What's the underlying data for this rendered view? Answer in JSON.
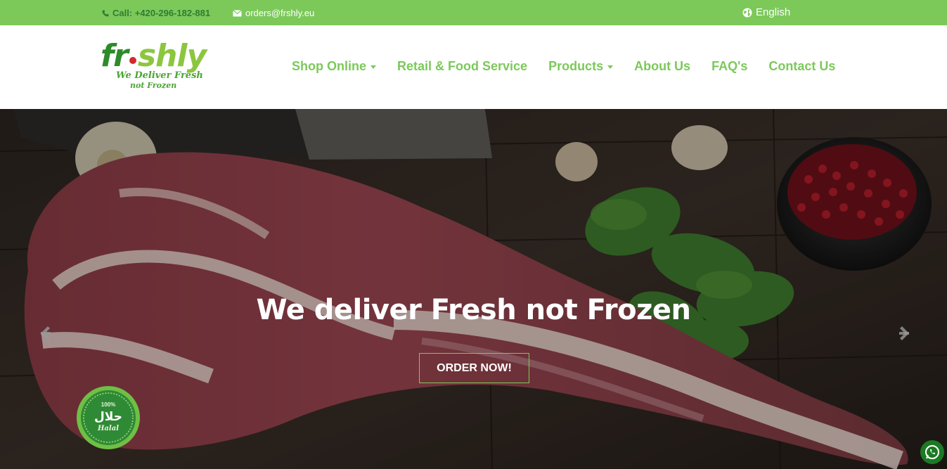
{
  "topbar": {
    "phone": "Call: +420-296-182-881",
    "email": "orders@frshly.eu",
    "language": "English",
    "bg_color": "#7cc95a"
  },
  "logo": {
    "word_a": "fr",
    "word_b": "shly",
    "tagline_1": "We Deliver Fresh",
    "tagline_2": "not Frozen"
  },
  "nav": {
    "items": [
      {
        "label": "Shop Online",
        "dropdown": true
      },
      {
        "label": "Retail & Food Service",
        "dropdown": false
      },
      {
        "label": "Products",
        "dropdown": true
      },
      {
        "label": "About Us",
        "dropdown": false
      },
      {
        "label": "FAQ's",
        "dropdown": false
      },
      {
        "label": "Contact Us",
        "dropdown": false
      }
    ],
    "color": "#7cc95a"
  },
  "hero": {
    "title": "We deliver Fresh not Frozen",
    "cta": "ORDER NOW!",
    "badge": {
      "top": "100%",
      "arabic": "حلال",
      "bottom": "Halal"
    }
  },
  "icons": [
    "phone-icon",
    "envelope-icon",
    "globe-icon",
    "chevron-left-icon",
    "chevron-right-icon",
    "whatsapp-icon"
  ]
}
